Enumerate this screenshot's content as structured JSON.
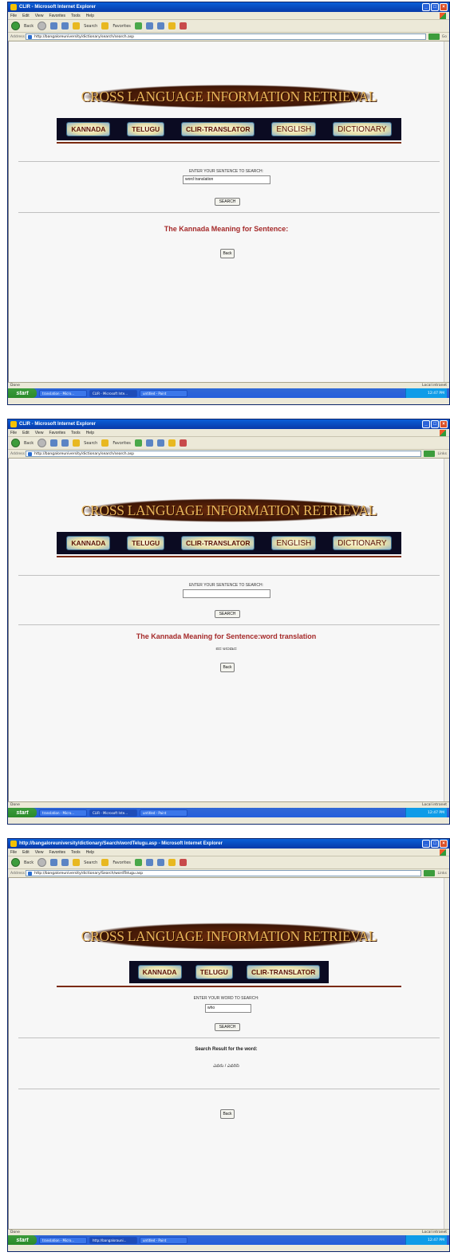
{
  "browser": {
    "menu": [
      "File",
      "Edit",
      "View",
      "Favorites",
      "Tools",
      "Help"
    ],
    "toolbar": {
      "back": "Back",
      "search": "Search",
      "favorites": "Favorites"
    },
    "address_label": "Address",
    "go_label": "Go",
    "links_label": "Links",
    "status_done": "Done",
    "status_zone": "Local intranet",
    "start_label": "start",
    "tray_time": "12:47 PM"
  },
  "site": {
    "banner": "CROSS LANGUAGE INFORMATION RETRIEVAL",
    "nav": {
      "kannada": "KANNADA",
      "telugu": "TELUGU",
      "clir": "CLIR-TRANSLATOR",
      "english": "ENGLISH",
      "dictionary": "DICTIONARY"
    },
    "search_button": "SEARCH",
    "back_button": "Back"
  },
  "screens": [
    {
      "title": "CLIR - Microsoft Internet Explorer",
      "url": "http://bangaloreuniversity/dictionary/search/search.asp",
      "tasks": [
        "translation - Micro...",
        "CLIR - Microsoft Inte...",
        "untitled - Paint"
      ],
      "prompt": "ENTER YOUR SENTENCE TO SEARCH:",
      "input_value": "word translation",
      "heading": "The Kannada Meaning for Sentence:",
      "result": ""
    },
    {
      "title": "CLIR - Microsoft Internet Explorer",
      "url": "http://bangaloreuniversity/dictionary/search/search.asp",
      "tasks": [
        "translation - Micro...",
        "CLIR - Microsoft Inte...",
        "untitled - Paint"
      ],
      "prompt": "ENTER YOUR SENTENCE TO SEARCH:",
      "input_value": "",
      "heading": "The Kannada Meaning for Sentence:word translation",
      "result": "ಪದ ಅನುವಾದ"
    },
    {
      "title": "http://bangaloreuniversity/dictionary/Search/wordTelugu.asp - Microsoft Internet Explorer",
      "url": "http://bangaloreuniversity/dictionary/Search/wordTelugu.asp",
      "tasks": [
        "translation - Micro...",
        "http://bangalorauni...",
        "untitled - Paint"
      ],
      "prompt": "ENTER YOUR WORD TO SEARCH:",
      "input_value": "who",
      "heading": "Search Result for the word:",
      "result": "ఎవరు / ఎవరిని"
    }
  ]
}
